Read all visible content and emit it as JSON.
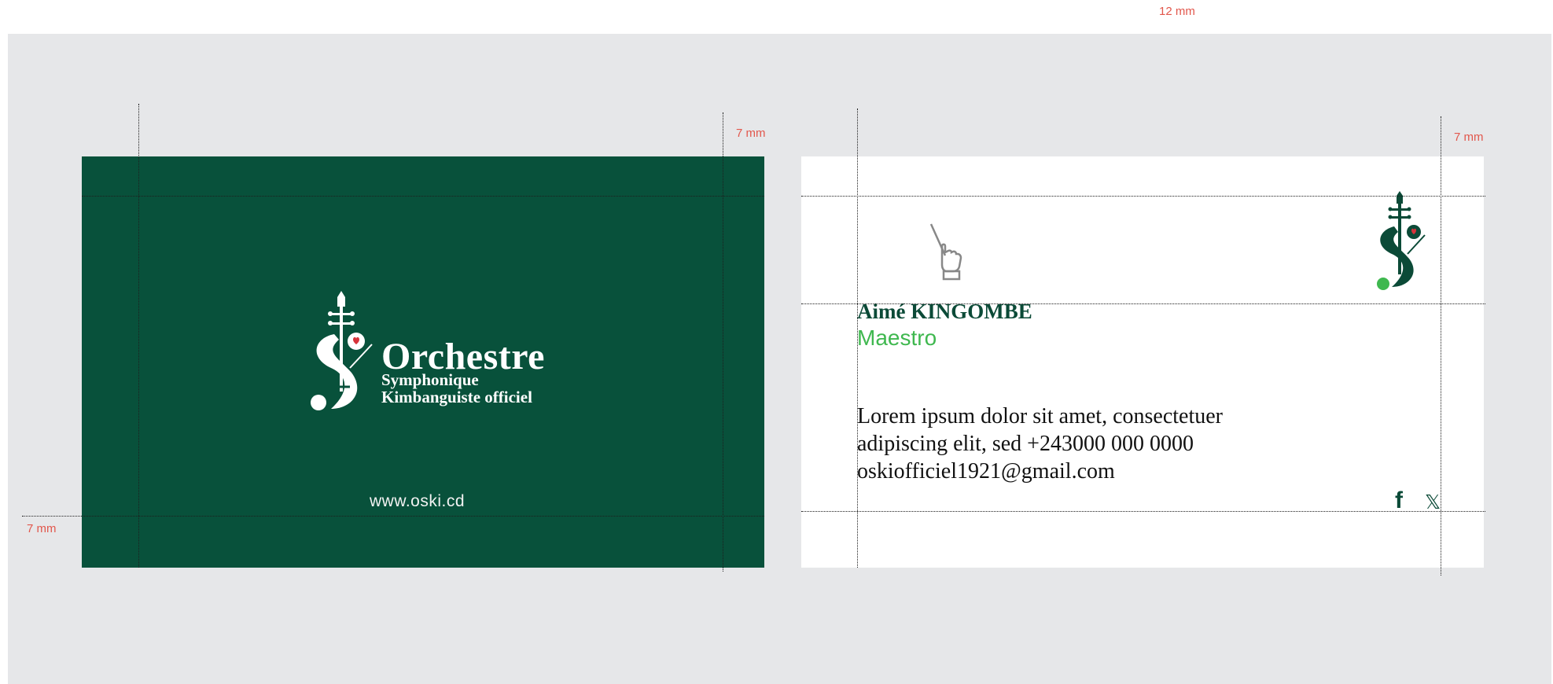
{
  "dimension_labels": {
    "top": "12 mm",
    "front_right": "7 mm",
    "front_left": "7 mm",
    "back_right": "7 mm"
  },
  "front": {
    "title": "Orchestre",
    "subtitle_line1": "Symphonique",
    "subtitle_line2": "Kimbanguiste officiel",
    "website": "www.oski.cd",
    "background_color": "#08513b"
  },
  "back": {
    "name": "Aimé KINGOMBE",
    "role": "Maestro",
    "text_line1": "Lorem ipsum dolor sit amet, consectetuer",
    "text_line2": "adipiscing elit, sed +243000 000 0000",
    "text_line3": "oskiofficiel1921@gmail.com",
    "social": {
      "facebook": "f",
      "x": "𝕏"
    },
    "icons": [
      "conductor-hand-icon",
      "violin-s-logo-icon",
      "facebook-icon",
      "x-icon"
    ]
  },
  "colors": {
    "brand_green": "#08513b",
    "accent_green": "#3fb84f",
    "accent_red": "#d7333a",
    "guide_label": "#e2574c",
    "board": "#e6e7e9"
  }
}
